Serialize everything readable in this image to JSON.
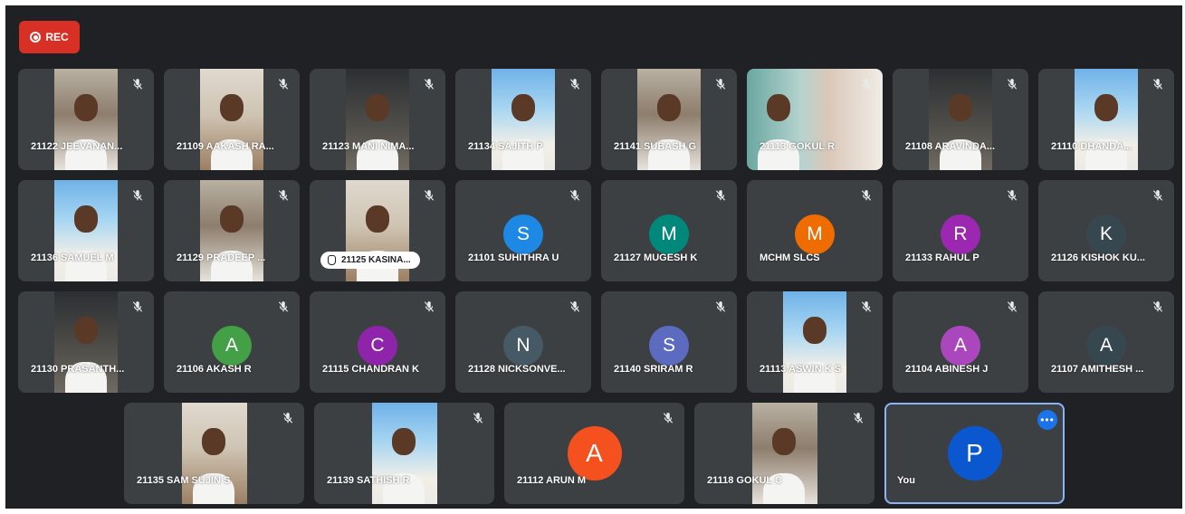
{
  "recording_badge": {
    "label": "REC",
    "color": "#d93025"
  },
  "icons": {
    "mic": "mic-off-icon",
    "more": "more-options-icon",
    "pin": "pin-icon",
    "record": "record-icon"
  },
  "rows": [
    [
      {
        "name": "21122 JEEVANAN...",
        "video": true
      },
      {
        "name": "21109 AAKASH RA...",
        "video": true
      },
      {
        "name": "21123 MANI NIMA...",
        "video": true
      },
      {
        "name": "21134 SAJITH P",
        "video": true
      },
      {
        "name": "21141 SUBASH G",
        "video": true
      },
      {
        "name": "21113 GOKUL R",
        "video": true
      },
      {
        "name": "21108 ARAVINDA...",
        "video": true
      },
      {
        "name": "21110 DHANDA...",
        "video": true
      }
    ],
    [
      {
        "name": "21136 SAMUEL M",
        "video": true
      },
      {
        "name": "21129 PRADEEP ...",
        "video": true
      },
      {
        "name": "21125 KASINA...",
        "video": true,
        "pinned": true
      },
      {
        "name": "21101 SUHITHRA U",
        "initial": "S",
        "color": "#1e88e5"
      },
      {
        "name": "21127 MUGESH K",
        "initial": "M",
        "color": "#00897b"
      },
      {
        "name": "MCHM SLCS",
        "initial": "M",
        "color": "#ef6c00"
      },
      {
        "name": "21133 RAHUL P",
        "initial": "R",
        "color": "#9c27b0"
      },
      {
        "name": "21126 KISHOK KU...",
        "initial": "K",
        "color": "#37474f"
      }
    ],
    [
      {
        "name": "21130 PRASANTH...",
        "video": true
      },
      {
        "name": "21106 AKASH R",
        "initial": "A",
        "color": "#43a047"
      },
      {
        "name": "21115 CHANDRAN K",
        "initial": "C",
        "color": "#8e24aa"
      },
      {
        "name": "21128 NICKSONVE...",
        "initial": "N",
        "color": "#455a64"
      },
      {
        "name": "21140 SRIRAM R",
        "initial": "S",
        "color": "#5c6bc0"
      },
      {
        "name": "21113 ASWIN K S",
        "video": true
      },
      {
        "name": "21104 ABINESH J",
        "initial": "A",
        "color": "#ab47bc"
      },
      {
        "name": "21107 AMITHESH ...",
        "initial": "A",
        "color": "#37474f"
      }
    ],
    [
      {
        "name": "21135 SAM SUJIN S",
        "video": true
      },
      {
        "name": "21139 SATHISH R",
        "video": true
      },
      {
        "name": "21112 ARUN M",
        "initial": "A",
        "color": "#f4511e"
      },
      {
        "name": "21118 GOKUL C",
        "video": true
      },
      {
        "name": "You",
        "initial": "P",
        "color": "#0b57d0",
        "self": true
      }
    ]
  ]
}
